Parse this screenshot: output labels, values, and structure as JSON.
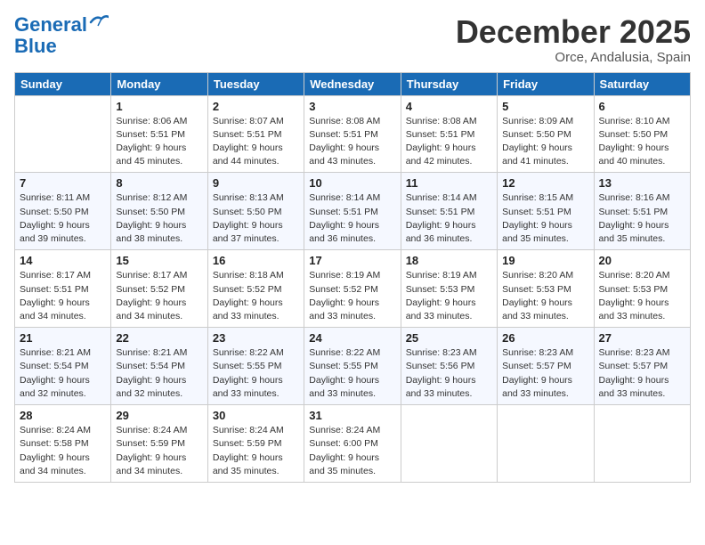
{
  "header": {
    "logo_line1": "General",
    "logo_line2": "Blue",
    "month": "December 2025",
    "location": "Orce, Andalusia, Spain"
  },
  "weekdays": [
    "Sunday",
    "Monday",
    "Tuesday",
    "Wednesday",
    "Thursday",
    "Friday",
    "Saturday"
  ],
  "weeks": [
    [
      {
        "day": "",
        "info": ""
      },
      {
        "day": "1",
        "info": "Sunrise: 8:06 AM\nSunset: 5:51 PM\nDaylight: 9 hours\nand 45 minutes."
      },
      {
        "day": "2",
        "info": "Sunrise: 8:07 AM\nSunset: 5:51 PM\nDaylight: 9 hours\nand 44 minutes."
      },
      {
        "day": "3",
        "info": "Sunrise: 8:08 AM\nSunset: 5:51 PM\nDaylight: 9 hours\nand 43 minutes."
      },
      {
        "day": "4",
        "info": "Sunrise: 8:08 AM\nSunset: 5:51 PM\nDaylight: 9 hours\nand 42 minutes."
      },
      {
        "day": "5",
        "info": "Sunrise: 8:09 AM\nSunset: 5:50 PM\nDaylight: 9 hours\nand 41 minutes."
      },
      {
        "day": "6",
        "info": "Sunrise: 8:10 AM\nSunset: 5:50 PM\nDaylight: 9 hours\nand 40 minutes."
      }
    ],
    [
      {
        "day": "7",
        "info": "Sunrise: 8:11 AM\nSunset: 5:50 PM\nDaylight: 9 hours\nand 39 minutes."
      },
      {
        "day": "8",
        "info": "Sunrise: 8:12 AM\nSunset: 5:50 PM\nDaylight: 9 hours\nand 38 minutes."
      },
      {
        "day": "9",
        "info": "Sunrise: 8:13 AM\nSunset: 5:50 PM\nDaylight: 9 hours\nand 37 minutes."
      },
      {
        "day": "10",
        "info": "Sunrise: 8:14 AM\nSunset: 5:51 PM\nDaylight: 9 hours\nand 36 minutes."
      },
      {
        "day": "11",
        "info": "Sunrise: 8:14 AM\nSunset: 5:51 PM\nDaylight: 9 hours\nand 36 minutes."
      },
      {
        "day": "12",
        "info": "Sunrise: 8:15 AM\nSunset: 5:51 PM\nDaylight: 9 hours\nand 35 minutes."
      },
      {
        "day": "13",
        "info": "Sunrise: 8:16 AM\nSunset: 5:51 PM\nDaylight: 9 hours\nand 35 minutes."
      }
    ],
    [
      {
        "day": "14",
        "info": "Sunrise: 8:17 AM\nSunset: 5:51 PM\nDaylight: 9 hours\nand 34 minutes."
      },
      {
        "day": "15",
        "info": "Sunrise: 8:17 AM\nSunset: 5:52 PM\nDaylight: 9 hours\nand 34 minutes."
      },
      {
        "day": "16",
        "info": "Sunrise: 8:18 AM\nSunset: 5:52 PM\nDaylight: 9 hours\nand 33 minutes."
      },
      {
        "day": "17",
        "info": "Sunrise: 8:19 AM\nSunset: 5:52 PM\nDaylight: 9 hours\nand 33 minutes."
      },
      {
        "day": "18",
        "info": "Sunrise: 8:19 AM\nSunset: 5:53 PM\nDaylight: 9 hours\nand 33 minutes."
      },
      {
        "day": "19",
        "info": "Sunrise: 8:20 AM\nSunset: 5:53 PM\nDaylight: 9 hours\nand 33 minutes."
      },
      {
        "day": "20",
        "info": "Sunrise: 8:20 AM\nSunset: 5:53 PM\nDaylight: 9 hours\nand 33 minutes."
      }
    ],
    [
      {
        "day": "21",
        "info": "Sunrise: 8:21 AM\nSunset: 5:54 PM\nDaylight: 9 hours\nand 32 minutes."
      },
      {
        "day": "22",
        "info": "Sunrise: 8:21 AM\nSunset: 5:54 PM\nDaylight: 9 hours\nand 32 minutes."
      },
      {
        "day": "23",
        "info": "Sunrise: 8:22 AM\nSunset: 5:55 PM\nDaylight: 9 hours\nand 33 minutes."
      },
      {
        "day": "24",
        "info": "Sunrise: 8:22 AM\nSunset: 5:55 PM\nDaylight: 9 hours\nand 33 minutes."
      },
      {
        "day": "25",
        "info": "Sunrise: 8:23 AM\nSunset: 5:56 PM\nDaylight: 9 hours\nand 33 minutes."
      },
      {
        "day": "26",
        "info": "Sunrise: 8:23 AM\nSunset: 5:57 PM\nDaylight: 9 hours\nand 33 minutes."
      },
      {
        "day": "27",
        "info": "Sunrise: 8:23 AM\nSunset: 5:57 PM\nDaylight: 9 hours\nand 33 minutes."
      }
    ],
    [
      {
        "day": "28",
        "info": "Sunrise: 8:24 AM\nSunset: 5:58 PM\nDaylight: 9 hours\nand 34 minutes."
      },
      {
        "day": "29",
        "info": "Sunrise: 8:24 AM\nSunset: 5:59 PM\nDaylight: 9 hours\nand 34 minutes."
      },
      {
        "day": "30",
        "info": "Sunrise: 8:24 AM\nSunset: 5:59 PM\nDaylight: 9 hours\nand 35 minutes."
      },
      {
        "day": "31",
        "info": "Sunrise: 8:24 AM\nSunset: 6:00 PM\nDaylight: 9 hours\nand 35 minutes."
      },
      {
        "day": "",
        "info": ""
      },
      {
        "day": "",
        "info": ""
      },
      {
        "day": "",
        "info": ""
      }
    ]
  ]
}
